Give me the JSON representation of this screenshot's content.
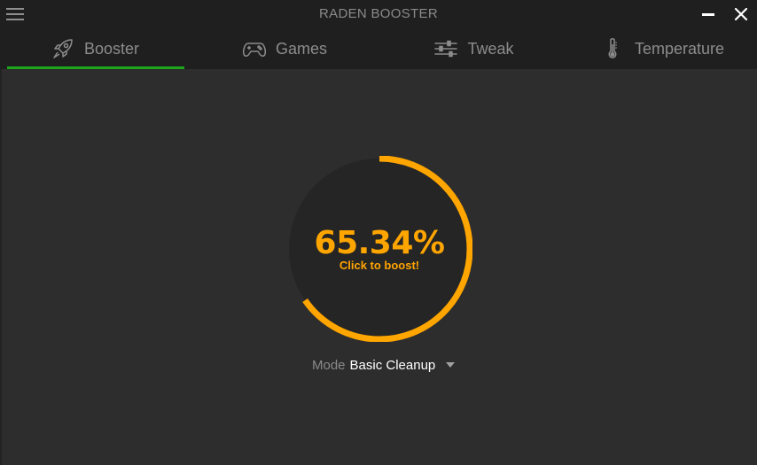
{
  "window": {
    "title": "RADEN BOOSTER"
  },
  "tabs": [
    {
      "id": "booster",
      "label": "Booster",
      "icon": "rocket-icon",
      "active": true
    },
    {
      "id": "games",
      "label": "Games",
      "icon": "gamepad-icon",
      "active": false
    },
    {
      "id": "tweak",
      "label": "Tweak",
      "icon": "sliders-icon",
      "active": false
    },
    {
      "id": "temperature",
      "label": "Temperature",
      "icon": "thermometer-icon",
      "active": false
    }
  ],
  "booster": {
    "percent_text": "65.34%",
    "percent_value": 65.34,
    "action_label": "Click to boost!",
    "mode_label": "Mode",
    "mode_value": "Basic Cleanup"
  },
  "colors": {
    "accent": "#ffa500",
    "tab_active": "#1aa51a",
    "background": "#2d2d2d",
    "bar": "#1f1f1f"
  }
}
